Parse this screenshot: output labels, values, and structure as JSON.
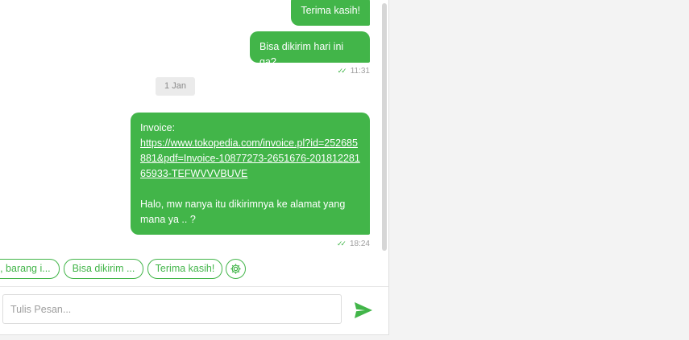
{
  "messages": [
    {
      "text": "Terima kasih!"
    },
    {
      "text": "Bisa dikirim hari ini ga?",
      "time": "11:31"
    },
    {
      "label": "Invoice:",
      "link": "https://www.tokopedia.com/invoice.pl?id=252685881&pdf=Invoice-10877273-2651676-20181228165933-TEFWVVVBUVE",
      "body": "Halo, mw nanya itu dikirimnya ke alamat yang mana ya .. ?",
      "time": "18:24"
    }
  ],
  "date_separator": "1 Jan",
  "status_icon": "double-check-icon",
  "quick_replies": [
    "i, barang i...",
    "Bisa dikirim ...",
    "Terima kasih!"
  ],
  "settings_icon": "gear-icon",
  "composer": {
    "placeholder": "Tulis Pesan...",
    "send_icon": "send-icon"
  },
  "colors": {
    "accent": "#42b549",
    "bubble_text": "#ffffff",
    "muted_text": "#9e9e9e"
  }
}
